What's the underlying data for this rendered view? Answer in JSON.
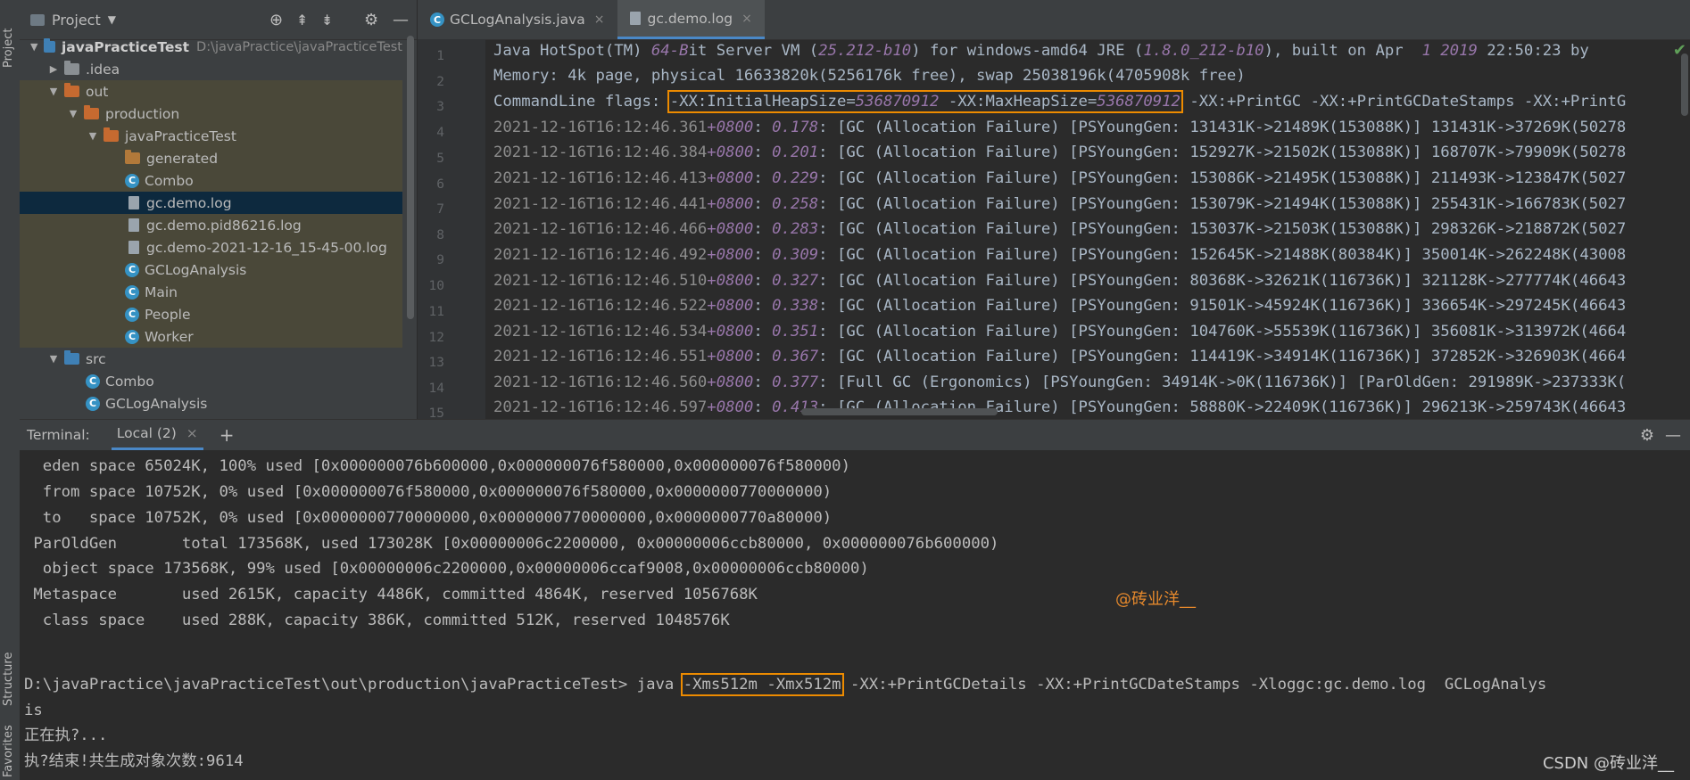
{
  "tool_strip": {
    "project_label": "Project",
    "structure_label": "Structure",
    "favorites_label": "Favorites"
  },
  "project_panel": {
    "title": "Project",
    "tree": [
      {
        "label": "javaPracticeTest",
        "path": "D:\\javaPractice\\javaPracticeTest"
      },
      {
        "label": ".idea"
      },
      {
        "label": "out"
      },
      {
        "label": "production"
      },
      {
        "label": "javaPracticeTest"
      },
      {
        "label": "generated"
      },
      {
        "label": "Combo"
      },
      {
        "label": "gc.demo.log"
      },
      {
        "label": "gc.demo.pid86216.log"
      },
      {
        "label": "gc.demo-2021-12-16_15-45-00.log"
      },
      {
        "label": "GCLogAnalysis"
      },
      {
        "label": "Main"
      },
      {
        "label": "People"
      },
      {
        "label": "Worker"
      },
      {
        "label": "src"
      },
      {
        "label": "Combo"
      },
      {
        "label": "GCLogAnalysis"
      }
    ]
  },
  "editor": {
    "tabs": [
      {
        "label": "GCLogAnalysis.java"
      },
      {
        "label": "gc.demo.log"
      }
    ],
    "line_numbers": [
      "1",
      "2",
      "3",
      "4",
      "5",
      "6",
      "7",
      "8",
      "9",
      "10",
      "11",
      "12",
      "13",
      "14",
      "15"
    ],
    "line1": {
      "a": "Java HotSpot(TM) ",
      "b": "64-B",
      "c": "it Server VM (",
      "d": "25.212-b10",
      "e": ") for windows-amd64 JRE (",
      "f": "1.8.0_212-b10",
      "g": "), built on Apr  ",
      "h": "1 2019",
      "i": " 22:50:23 by"
    },
    "line2": "Memory: 4k page, physical 16633820k(5256176k free), swap 25038196k(4705908k free)",
    "line3": {
      "prefix": "CommandLine flags: ",
      "f1": "-XX:InitialHeapSize=",
      "v1": "536870912",
      "f2": " -XX:MaxHeapSize=",
      "v2": "536870912",
      "rest": " -XX:+PrintGC -XX:+PrintGCDateStamps -XX:+PrintG"
    },
    "gc_lines": [
      {
        "ts": "2021-12-16T16:12:46.361",
        "tz": "+0800",
        "sep": ": ",
        "t": "0.178",
        "msg": ": [GC (Allocation Failure) [PSYoungGen: 131431K->21489K(153088K)] 131431K->37269K(50278"
      },
      {
        "ts": "2021-12-16T16:12:46.384",
        "tz": "+0800",
        "sep": ": ",
        "t": "0.201",
        "msg": ": [GC (Allocation Failure) [PSYoungGen: 152927K->21502K(153088K)] 168707K->79909K(50278"
      },
      {
        "ts": "2021-12-16T16:12:46.413",
        "tz": "+0800",
        "sep": ": ",
        "t": "0.229",
        "msg": ": [GC (Allocation Failure) [PSYoungGen: 153086K->21495K(153088K)] 211493K->123847K(5027"
      },
      {
        "ts": "2021-12-16T16:12:46.441",
        "tz": "+0800",
        "sep": ": ",
        "t": "0.258",
        "msg": ": [GC (Allocation Failure) [PSYoungGen: 153079K->21494K(153088K)] 255431K->166783K(5027"
      },
      {
        "ts": "2021-12-16T16:12:46.466",
        "tz": "+0800",
        "sep": ": ",
        "t": "0.283",
        "msg": ": [GC (Allocation Failure) [PSYoungGen: 153037K->21503K(153088K)] 298326K->218872K(5027"
      },
      {
        "ts": "2021-12-16T16:12:46.492",
        "tz": "+0800",
        "sep": ": ",
        "t": "0.309",
        "msg": ": [GC (Allocation Failure) [PSYoungGen: 152645K->21488K(80384K)] 350014K->262248K(43008"
      },
      {
        "ts": "2021-12-16T16:12:46.510",
        "tz": "+0800",
        "sep": ": ",
        "t": "0.327",
        "msg": ": [GC (Allocation Failure) [PSYoungGen: 80368K->32621K(116736K)] 321128K->277774K(46643"
      },
      {
        "ts": "2021-12-16T16:12:46.522",
        "tz": "+0800",
        "sep": ": ",
        "t": "0.338",
        "msg": ": [GC (Allocation Failure) [PSYoungGen: 91501K->45924K(116736K)] 336654K->297245K(46643"
      },
      {
        "ts": "2021-12-16T16:12:46.534",
        "tz": "+0800",
        "sep": ": ",
        "t": "0.351",
        "msg": ": [GC (Allocation Failure) [PSYoungGen: 104760K->55539K(116736K)] 356081K->313972K(4664"
      },
      {
        "ts": "2021-12-16T16:12:46.551",
        "tz": "+0800",
        "sep": ": ",
        "t": "0.367",
        "msg": ": [GC (Allocation Failure) [PSYoungGen: 114419K->34914K(116736K)] 372852K->326903K(4664"
      },
      {
        "ts": "2021-12-16T16:12:46.560",
        "tz": "+0800",
        "sep": ": ",
        "t": "0.377",
        "msg": ": [Full GC (Ergonomics) [PSYoungGen: 34914K->0K(116736K)] [ParOldGen: 291989K->237333K("
      },
      {
        "ts": "2021-12-16T16:12:46.597",
        "tz": "+0800",
        "sep": ": ",
        "t": "0.413",
        "msg": ": [GC (Allocation Failure) [PSYoungGen: 58880K->22409K(116736K)] 296213K->259743K(46643"
      }
    ]
  },
  "terminal": {
    "label": "Terminal:",
    "tab": "Local (2)",
    "lines": [
      "  eden space 65024K, 100% used [0x000000076b600000,0x000000076f580000,0x000000076f580000)",
      "  from space 10752K, 0% used [0x000000076f580000,0x000000076f580000,0x0000000770000000)",
      "  to   space 10752K, 0% used [0x0000000770000000,0x0000000770000000,0x0000000770a80000)",
      " ParOldGen       total 173568K, used 173028K [0x00000006c2200000, 0x00000006ccb80000, 0x000000076b600000)",
      "  object space 173568K, 99% used [0x00000006c2200000,0x00000006ccaf9008,0x00000006ccb80000)",
      " Metaspace       used 2615K, capacity 4486K, committed 4864K, reserved 1056768K",
      "  class space    used 288K, capacity 386K, committed 512K, reserved 1048576K"
    ],
    "cmd": {
      "prompt": "D:\\javaPractice\\javaPracticeTest\\out\\production\\javaPracticeTest> java ",
      "flags": "-Xms512m -Xmx512m",
      "rest": " -XX:+PrintGCDetails -XX:+PrintGCDateStamps -Xloggc:gc.demo.log  GCLogAnalys",
      "wrap": "is"
    },
    "out1": "正在执?...",
    "out2": "执?结束!共生成对象次数:9614"
  },
  "watermark": "@砖业洋__",
  "footer": "CSDN @砖业洋__",
  "colors": {
    "highlight_box": "#ed8b00",
    "selection": "#0d293e",
    "folder_orange": "#c66a30",
    "folder_blue": "#3f80b5"
  }
}
